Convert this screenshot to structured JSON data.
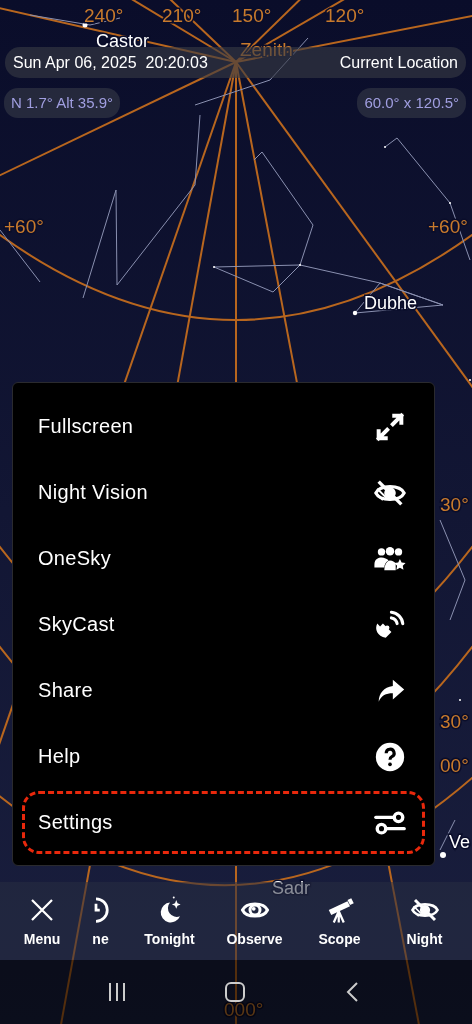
{
  "sky_map": {
    "labels": [
      {
        "text": "240°",
        "kind": "grid"
      },
      {
        "text": "210°",
        "kind": "grid"
      },
      {
        "text": "150°",
        "kind": "grid"
      },
      {
        "text": "120°",
        "kind": "grid"
      },
      {
        "text": "Castor",
        "kind": "star"
      },
      {
        "text": "Zenith",
        "kind": "grid"
      },
      {
        "text": "+60°",
        "kind": "grid"
      },
      {
        "text": "+60°",
        "kind": "grid"
      },
      {
        "text": "Dubhe",
        "kind": "star"
      },
      {
        "text": "30°",
        "kind": "grid"
      },
      {
        "text": "30°",
        "kind": "grid"
      },
      {
        "text": "00°",
        "kind": "grid"
      },
      {
        "text": "Ve",
        "kind": "star"
      },
      {
        "text": "Sadr",
        "kind": "star"
      },
      {
        "text": "000°",
        "kind": "grid"
      }
    ]
  },
  "header": {
    "datetime": "Sun Apr 06, 2025  20:20:03",
    "location": "Current Location"
  },
  "readouts": {
    "pointing": "N 1.7° Alt 35.9°",
    "field_of_view": "60.0° x 120.5°"
  },
  "menu": {
    "items": [
      {
        "label": "Fullscreen",
        "highlighted": false
      },
      {
        "label": "Night Vision",
        "highlighted": false
      },
      {
        "label": "OneSky",
        "highlighted": false
      },
      {
        "label": "SkyCast",
        "highlighted": false
      },
      {
        "label": "Share",
        "highlighted": false
      },
      {
        "label": "Help",
        "highlighted": false
      },
      {
        "label": "Settings",
        "highlighted": true
      }
    ]
  },
  "toolbar": [
    {
      "label": "Menu"
    },
    {
      "label": "ne"
    },
    {
      "label": "Tonight"
    },
    {
      "label": "Observe"
    },
    {
      "label": "Scope"
    },
    {
      "label": "Night"
    }
  ]
}
